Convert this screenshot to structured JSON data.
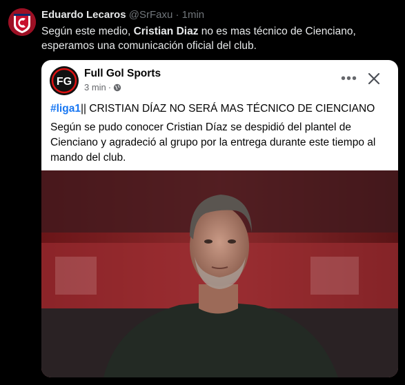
{
  "tweet": {
    "author_name": "Eduardo Lecaros",
    "handle": "@SrFaxu",
    "separator": "·",
    "time": "1min",
    "text_before": "Según este medio, ",
    "text_bold": "Cristian Diaz",
    "text_after": " no es mas técnico de Cienciano, esperamos una comunicación oficial del club."
  },
  "card": {
    "page_name": "Full Gol Sports",
    "logo_text": "FG",
    "time": "3 min",
    "separator": "·",
    "more_label": "•••",
    "hashtag": "#liga1",
    "title_rest": "|| CRISTIAN DÍAZ NO SERÁ MAS TÉCNICO DE CIENCIANO",
    "body": "Según se pudo conocer Cristian Díaz se despidió del plantel de Cienciano y agradeció al grupo por la entrega durante este tiempo al mando del club."
  },
  "icons": {
    "avatar": "club-crest-icon",
    "privacy": "globe-icon",
    "more": "more-options-icon",
    "close": "close-icon"
  },
  "colors": {
    "background": "#000000",
    "tweet_text": "#e7e9ea",
    "muted": "#71767b",
    "card_bg": "#ffffff",
    "hashtag": "#1877f2",
    "crest_red": "#b3102a"
  }
}
